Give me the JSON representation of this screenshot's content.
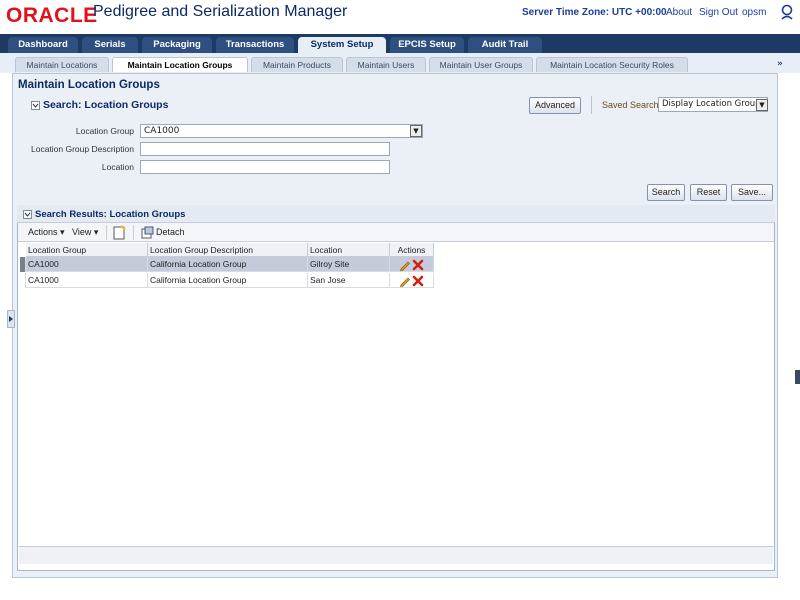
{
  "header": {
    "logo": "ORACLE",
    "app_title": "Pedigree and Serialization Manager",
    "server_time": "Server Time Zone: UTC +00:00",
    "links": [
      "About",
      "Sign Out",
      "opsm"
    ]
  },
  "tabs": [
    "Dashboard",
    "Serials",
    "Packaging",
    "Transactions",
    "System Setup",
    "EPCIS Setup",
    "Audit Trail"
  ],
  "active_tab": "System Setup",
  "subtabs": [
    "Maintain Locations",
    "Maintain Location Groups",
    "Maintain Products",
    "Maintain Users",
    "Maintain User Groups",
    "Maintain Location Security Roles"
  ],
  "active_subtab": "Maintain Location Groups",
  "subbar_more": "»",
  "page_title": "Maintain Location Groups",
  "search": {
    "title": "Search: Location Groups",
    "advanced_label": "Advanced",
    "saved_search_label": "Saved Search",
    "saved_search_value": "Display Location Groups",
    "fields": {
      "location_group_label": "Location Group",
      "location_group_value": "CA1000",
      "description_label": "Location Group Description",
      "description_value": "",
      "location_label": "Location",
      "location_value": ""
    },
    "buttons": {
      "search": "Search",
      "reset": "Reset",
      "save": "Save..."
    }
  },
  "results": {
    "title": "Search Results: Location Groups",
    "toolbar": {
      "actions": "Actions",
      "view": "View",
      "detach": "Detach"
    },
    "columns": [
      "Location Group",
      "Location Group Description",
      "Location",
      "Actions"
    ],
    "rows": [
      {
        "group": "CA1000",
        "description": "California Location Group",
        "location": "Gilroy Site",
        "selected": true
      },
      {
        "group": "CA1000",
        "description": "California Location Group",
        "location": "San Jose",
        "selected": false
      }
    ]
  },
  "colors": {
    "oracle_red": "#e0121b",
    "header_navy": "#1c3a64",
    "link_blue": "#1d3b9a"
  }
}
